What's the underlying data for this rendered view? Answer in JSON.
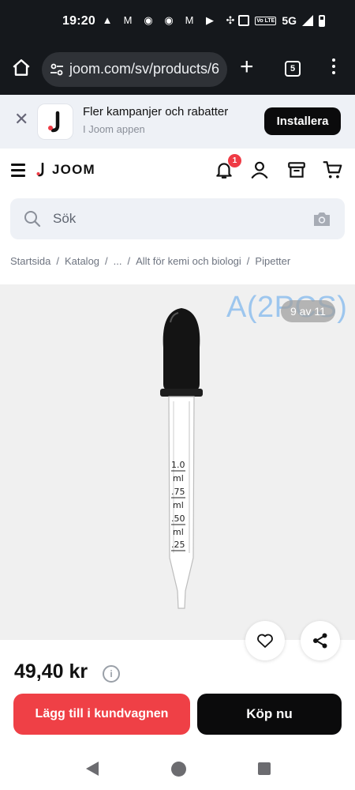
{
  "status_bar": {
    "time": "19:20",
    "network": "5G",
    "volte": "Vo LTE",
    "notification_icons": [
      "warning-icon",
      "gmail-icon",
      "chrome-icon",
      "chrome-icon",
      "gmail-icon",
      "youtube-icon",
      "pinwheel-icon"
    ]
  },
  "browser": {
    "url": "joom.com/sv/products/6",
    "tab_count": "5"
  },
  "app_banner": {
    "title": "Fler kampanjer och rabatter",
    "subtitle": "I Joom appen",
    "install_label": "Installera"
  },
  "header": {
    "brand": "JOOM",
    "notification_count": "1",
    "accent_color": "#ef3b45"
  },
  "search": {
    "placeholder": "Sök"
  },
  "breadcrumb": [
    "Startsida",
    "/",
    "Katalog",
    "/",
    "...",
    "/",
    "Allt för kemi och biologi",
    "/",
    "Pipetter"
  ],
  "gallery": {
    "watermark": "A(2PCS)",
    "counter": "9 av 11",
    "scale_marks": [
      "1.0",
      "ml",
      ".75",
      "ml",
      ".50",
      "ml",
      ".25"
    ]
  },
  "product": {
    "price": "49,40 kr",
    "info_glyph": "i"
  },
  "actions": {
    "add_to_cart": "Lägg till i kundvagnen",
    "buy_now": "Köp nu"
  }
}
